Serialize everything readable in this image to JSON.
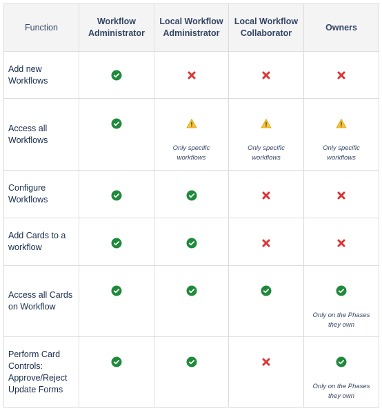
{
  "colors": {
    "check": "#1e8a3a",
    "cross": "#de3333",
    "warn": "#f6c342"
  },
  "headers": [
    "Function",
    "Workflow Administrator",
    "Local Workflow Administrator",
    "Local Workflow Collaborator",
    "Owners"
  ],
  "header_lines": [
    [
      "Function"
    ],
    [
      "Workflow",
      "Administrator"
    ],
    [
      "Local Workflow",
      "Administrator"
    ],
    [
      "Local Workflow",
      "Collaborator"
    ],
    [
      "Owners"
    ]
  ],
  "rows": [
    {
      "function": [
        "Add new",
        "Workflows"
      ],
      "cells": [
        {
          "icon": "check-icon"
        },
        {
          "icon": "cross-icon"
        },
        {
          "icon": "cross-icon"
        },
        {
          "icon": "cross-icon"
        }
      ]
    },
    {
      "function": [
        "Access all",
        "Workflows"
      ],
      "cells": [
        {
          "icon": "check-icon"
        },
        {
          "icon": "warning-icon",
          "note": [
            "Only specific",
            "workflows"
          ]
        },
        {
          "icon": "warning-icon",
          "note": [
            "Only specific",
            "workflows"
          ]
        },
        {
          "icon": "warning-icon",
          "note": [
            "Only specific",
            "workflows"
          ]
        }
      ]
    },
    {
      "function": [
        "Configure",
        "Workflows"
      ],
      "cells": [
        {
          "icon": "check-icon"
        },
        {
          "icon": "check-icon"
        },
        {
          "icon": "cross-icon"
        },
        {
          "icon": "cross-icon"
        }
      ]
    },
    {
      "function": [
        "Add Cards to a",
        "workflow"
      ],
      "cells": [
        {
          "icon": "check-icon"
        },
        {
          "icon": "check-icon"
        },
        {
          "icon": "cross-icon"
        },
        {
          "icon": "cross-icon"
        }
      ]
    },
    {
      "function": [
        "Access all Cards",
        "on Workflow"
      ],
      "cells": [
        {
          "icon": "check-icon"
        },
        {
          "icon": "check-icon"
        },
        {
          "icon": "check-icon"
        },
        {
          "icon": "check-icon",
          "note": [
            "Only on the Phases",
            "they own"
          ]
        }
      ]
    },
    {
      "function": [
        "Perform Card",
        "Controls:",
        "Approve/Reject",
        "Update Forms"
      ],
      "cells": [
        {
          "icon": "check-icon"
        },
        {
          "icon": "check-icon"
        },
        {
          "icon": "cross-icon"
        },
        {
          "icon": "check-icon",
          "note": [
            "Only on the Phases",
            "they own"
          ]
        }
      ]
    }
  ]
}
